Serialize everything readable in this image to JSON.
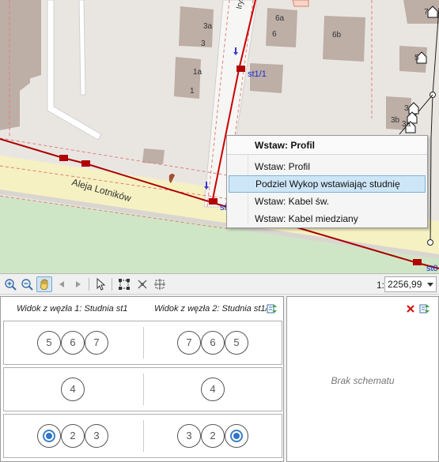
{
  "map": {
    "street_name": "Aleja Lotników",
    "street_name_top": "Irys",
    "building_labels": [
      "3a",
      "3",
      "1a",
      "1",
      "6a",
      "6",
      "6b",
      "7",
      "5",
      "3",
      "3b",
      "3a"
    ],
    "node_labels": {
      "st1_1": "st1/1",
      "st1": "st",
      "st0": "st0"
    },
    "colors": {
      "cable": "#cc0000",
      "node": "#b10000",
      "road": "#f6f1c5",
      "grass": "#cde6c4",
      "building": "#bdaea6"
    }
  },
  "context_menu": {
    "header": "Wstaw: Profil",
    "items": [
      {
        "label": "Wstaw: Profil",
        "highlighted": false
      },
      {
        "label": "Podziel Wykop wstawiając studnię",
        "highlighted": true
      },
      {
        "label": "Wstaw: Kabel św.",
        "highlighted": false
      },
      {
        "label": "Wstaw: Kabel miedziany",
        "highlighted": false
      }
    ]
  },
  "toolbar": {
    "icons": [
      "zoom-in-icon",
      "zoom-out-icon",
      "pan-hand-icon",
      "back-arrow-icon",
      "forward-arrow-icon",
      "select-pointer-icon",
      "select-area-icon",
      "delete-selection-icon",
      "move-selection-icon"
    ],
    "scale_prefix": "1:",
    "scale_value": "2256,99"
  },
  "left_panel": {
    "view1_title": "Widok z węzła 1: Studnia st1",
    "view2_title": "Widok z węzła 2: Studnia st1/",
    "rows": [
      {
        "left": [
          "5",
          "6",
          "7"
        ],
        "right": [
          "7",
          "6",
          "5"
        ]
      },
      {
        "left": [
          "4"
        ],
        "right": [
          "4"
        ]
      },
      {
        "left": [
          "",
          "2",
          "3"
        ],
        "right": [
          "3",
          "2",
          ""
        ]
      }
    ]
  },
  "right_panel": {
    "empty_text": "Brak schematu"
  }
}
